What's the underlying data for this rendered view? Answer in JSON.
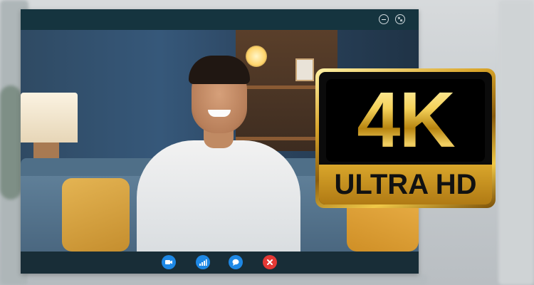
{
  "window": {
    "controls": {
      "minimize_icon": "minimize-icon",
      "fullscreen_icon": "exit-fullscreen-icon"
    }
  },
  "control_bar": {
    "buttons": [
      {
        "icon": "video-camera-icon",
        "color": "#1e88e5"
      },
      {
        "icon": "signal-bars-icon",
        "color": "#1e88e5"
      },
      {
        "icon": "chat-bubble-icon",
        "color": "#1e88e5"
      },
      {
        "icon": "close-icon",
        "color": "#e53935"
      }
    ]
  },
  "badge": {
    "resolution": "4K",
    "label": "ULTRA HD",
    "accent": "#d9a52b"
  }
}
